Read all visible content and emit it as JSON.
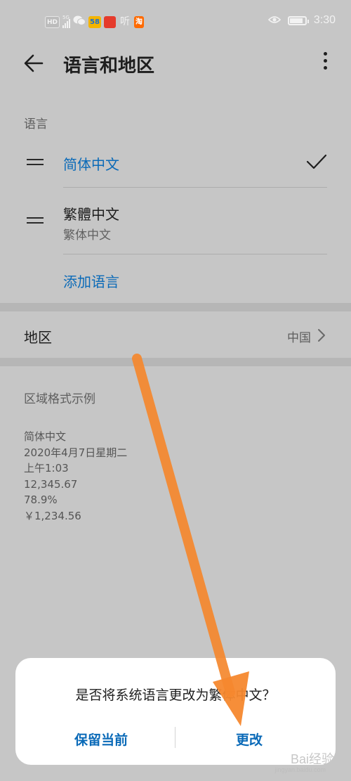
{
  "status_bar": {
    "hd_chip": "HD",
    "signal_label": "5G",
    "app_chip_58": "58",
    "app_chip_ting": "听",
    "app_chip_tao": "淘",
    "time": "3:30"
  },
  "header": {
    "title": "语言和地区"
  },
  "language_section": {
    "label": "语言",
    "items": [
      {
        "name": "简体中文",
        "subtitle": "",
        "selected": true
      },
      {
        "name": "繁體中文",
        "subtitle": "繁体中文",
        "selected": false
      }
    ],
    "add_label": "添加语言"
  },
  "region": {
    "label": "地区",
    "value": "中国"
  },
  "format_example": {
    "label": "区域格式示例",
    "lines": [
      "简体中文",
      "2020年4月7日星期二",
      "上午1:03",
      "12,345.67",
      "78.9%",
      "￥1,234.56"
    ]
  },
  "dialog": {
    "message": "是否将系统语言更改为繁体中文？",
    "keep_label": "保留当前",
    "change_label": "更改"
  },
  "watermark": {
    "text": "Bai经验",
    "sub": "jingyan.baidu.com"
  },
  "colors": {
    "accent": "#0a6ab8",
    "arrow": "#f5882e",
    "dimmed_background": "#c6c6c6"
  }
}
